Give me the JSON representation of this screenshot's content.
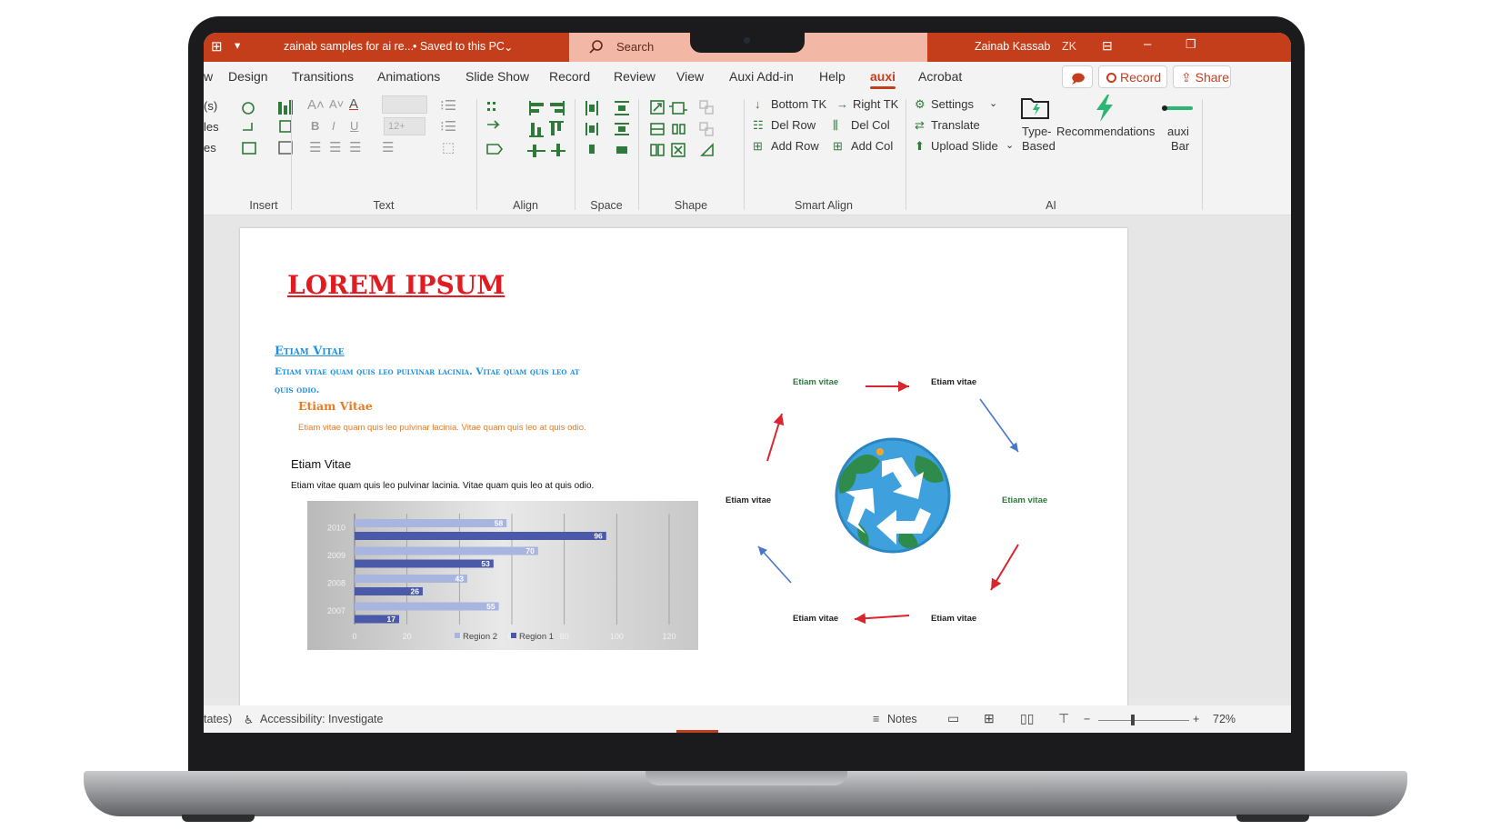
{
  "titlebar": {
    "doc_title": "zainab samples for ai re...",
    "save_status": "• Saved to this PC",
    "search_placeholder": "Search",
    "user_name": "Zainab Kassab",
    "user_initials": "ZK"
  },
  "menu": {
    "tabs": [
      "w",
      "Design",
      "Transitions",
      "Animations",
      "Slide Show",
      "Record",
      "Review",
      "View",
      "Auxi Add-in",
      "Help",
      "auxi",
      "Acrobat"
    ],
    "active_tab": "auxi",
    "record_label": "Record",
    "share_label": "Share"
  },
  "ribbon": {
    "left_clip": [
      "(s)",
      "les",
      "es"
    ],
    "group_labels": {
      "insert": "Insert",
      "text": "Text",
      "align": "Align",
      "space": "Space",
      "shape": "Shape",
      "smart_align": "Smart Align",
      "ai": "AI"
    },
    "font_size_placeholder": "12+",
    "smart_align_buttons": {
      "bottom_tk": "Bottom TK",
      "right_tk": "Right TK",
      "del_row": "Del Row",
      "del_col": "Del Col",
      "add_row": "Add Row",
      "add_col": "Add Col"
    },
    "ai_buttons": {
      "settings": "Settings",
      "translate": "Translate",
      "upload_slide": "Upload Slide",
      "type_based_1": "Type-",
      "type_based_2": "Based",
      "recommendations": "Recommendations",
      "auxi_bar_1": "auxi",
      "auxi_bar_2": "Bar"
    }
  },
  "slide": {
    "title": "LOREM IPSUM",
    "heading1": "Etiam Vitae",
    "body1_line1": "Etiam vitae quam quis leo pulvinar lacinia. Vitae quam quis leo at",
    "body1_line2": "quis odio.",
    "heading2": "Etiam Vitae",
    "body2": "Etiam vitae quam quis leo pulvinar lacinia. Vitae quam quis leo at quis odio.",
    "heading3": "Etiam Vitae",
    "body3": "Etiam vitae quam quis leo pulvinar lacinia. Vitae quam quis leo at quis odio.",
    "cycle_labels": [
      "Etiam vitae",
      "Etiam vitae",
      "Etiam vitae",
      "Etiam vitae",
      "Etiam vitae",
      "Etiam vitae"
    ],
    "colors": {
      "title_red": "#e01b22",
      "heading_blue": "#1e90e0",
      "orange": "#e87a22",
      "arrow_red": "#d8262e",
      "arrow_blue": "#4a78c8"
    }
  },
  "chart_data": {
    "type": "bar",
    "orientation": "horizontal",
    "categories": [
      "2007",
      "2008",
      "2009",
      "2010"
    ],
    "series": [
      {
        "name": "Region 1",
        "values": [
          17,
          26,
          53,
          96
        ],
        "color": "#4a5aa8"
      },
      {
        "name": "Region 2",
        "values": [
          55,
          43,
          70,
          58
        ],
        "color": "#a7b5df"
      }
    ],
    "xlim": [
      0,
      120
    ],
    "xticks": [
      0,
      20,
      40,
      60,
      80,
      100,
      120
    ],
    "grid": true,
    "legend": "bottom"
  },
  "statusbar": {
    "left_clip": "tates)",
    "accessibility": "Accessibility: Investigate",
    "notes": "Notes",
    "zoom": "72%"
  }
}
